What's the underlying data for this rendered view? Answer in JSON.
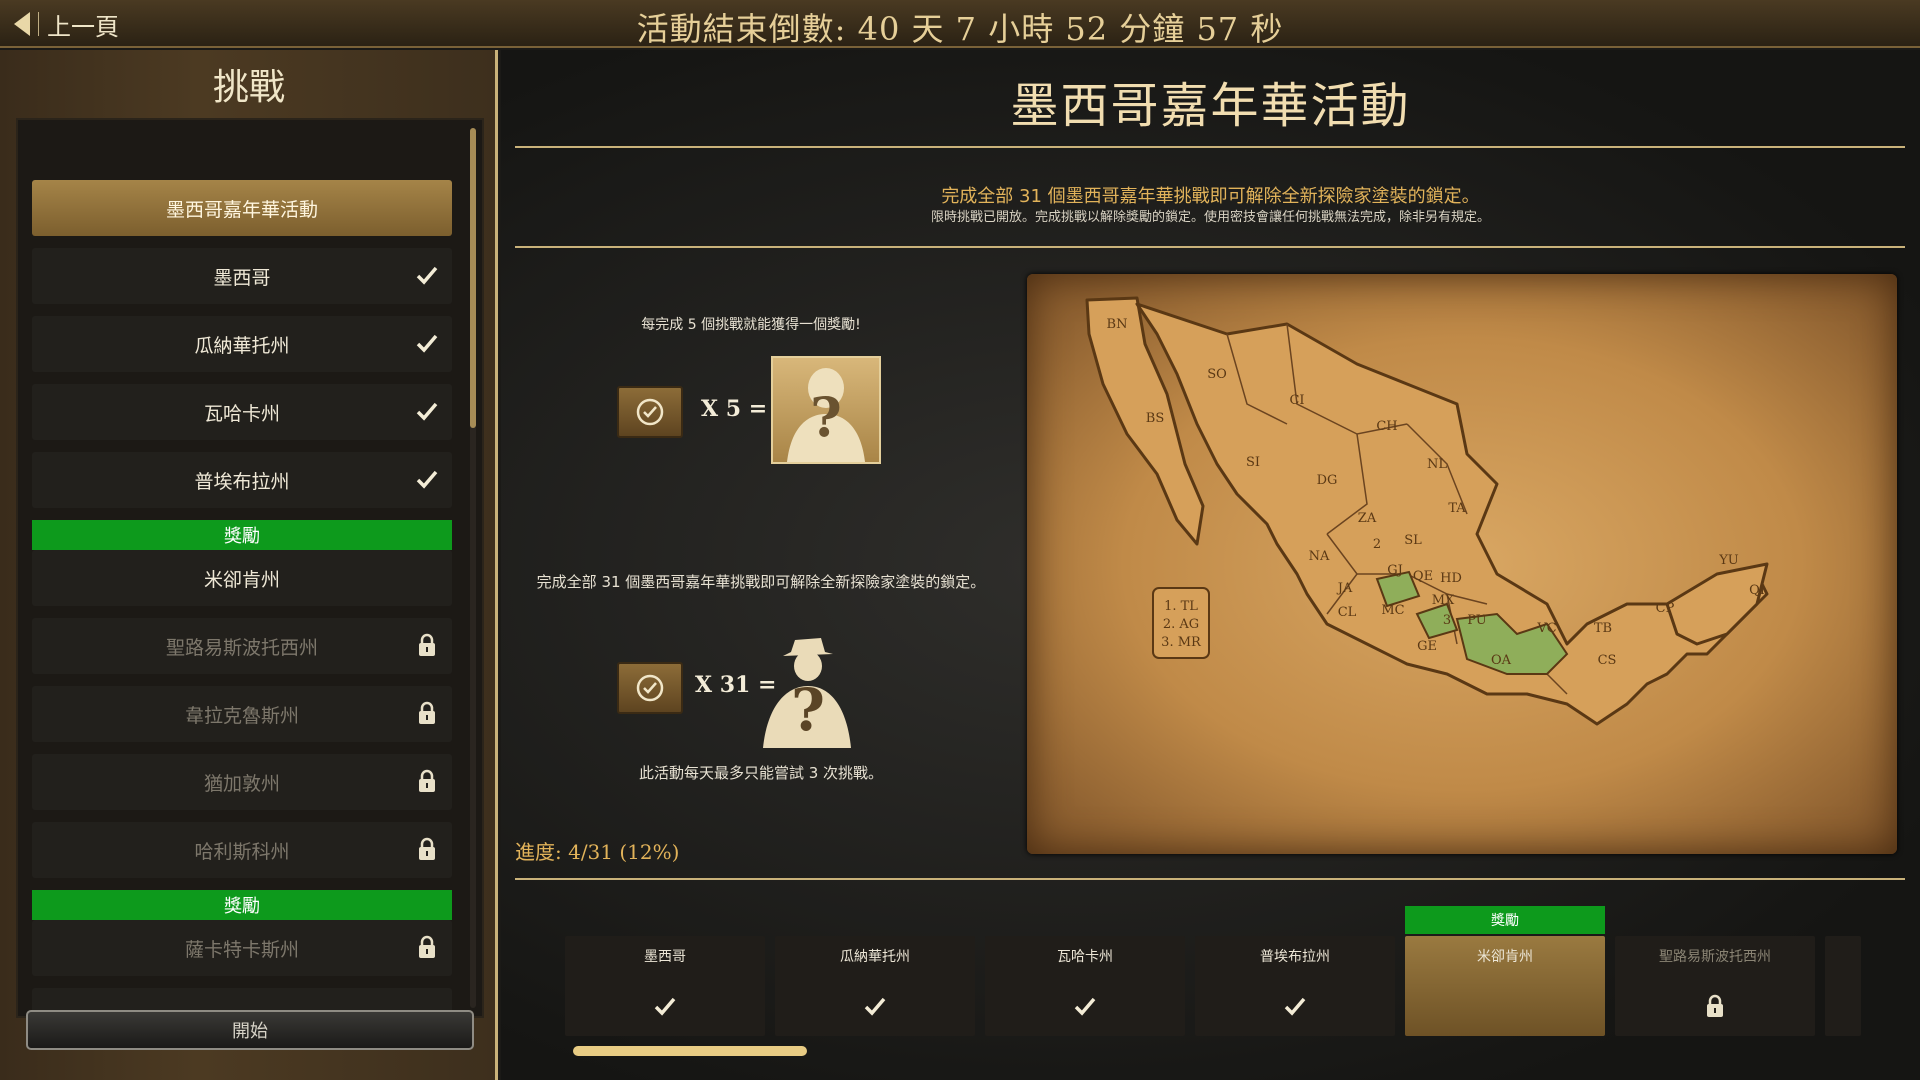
{
  "header": {
    "back_label": "上一頁",
    "countdown": "活動結束倒數: 40 天 7 小時 52 分鐘 57 秒"
  },
  "sidebar": {
    "title": "挑戰",
    "items": [
      {
        "label": "墨西哥嘉年華活動",
        "state": "active"
      },
      {
        "label": "墨西哥",
        "state": "done"
      },
      {
        "label": "瓜納華托州",
        "state": "done"
      },
      {
        "label": "瓦哈卡州",
        "state": "done"
      },
      {
        "label": "普埃布拉州",
        "state": "done"
      },
      {
        "label": "米卻肯州",
        "state": "open"
      },
      {
        "label": "聖路易斯波托西州",
        "state": "locked"
      },
      {
        "label": "韋拉克魯斯州",
        "state": "locked"
      },
      {
        "label": "猶加敦州",
        "state": "locked"
      },
      {
        "label": "哈利斯科州",
        "state": "locked"
      },
      {
        "label": "薩卡特卡斯州",
        "state": "locked"
      }
    ],
    "reward_label": "獎勵",
    "start_label": "開始"
  },
  "main": {
    "title": "墨西哥嘉年華活動",
    "desc_main": "完成全部 31 個墨西哥嘉年華挑戰即可解除全新探險家塗裝的鎖定。",
    "desc_sub": "限時挑戰已開放。完成挑戰以解除獎勵的鎖定。使用密技會讓任何挑戰無法完成，除非另有規定。",
    "reward5_caption": "每完成 5 個挑戰就能獲得一個獎勵!",
    "reward5_mult": "X 5 =",
    "reward31_caption": "完成全部 31 個墨西哥嘉年華挑戰即可解除全新探險家塗裝的鎖定。",
    "reward31_mult": "X 31 =",
    "daily_note": "此活動每天最多只能嘗試 3 次挑戰。",
    "progress": "進度: 4/31 (12%)"
  },
  "map": {
    "legend": [
      "1. TL",
      "2. AG",
      "3. MR"
    ],
    "labels": [
      "BN",
      "SO",
      "CI",
      "CH",
      "BS",
      "SI",
      "DG",
      "NL",
      "TA",
      "ZA",
      "SL",
      "NA",
      "JA",
      "GJ",
      "QE",
      "HD",
      "MX",
      "MC",
      "CL",
      "PU",
      "GE",
      "OA",
      "VC",
      "TB",
      "CP",
      "CS",
      "YU",
      "QI",
      "2",
      "3"
    ],
    "completed_color": "#8fae5a"
  },
  "carousel": {
    "reward_tag": "獎勵",
    "cards": [
      {
        "label": "墨西哥",
        "state": "done"
      },
      {
        "label": "瓜納華托州",
        "state": "done"
      },
      {
        "label": "瓦哈卡州",
        "state": "done"
      },
      {
        "label": "普埃布拉州",
        "state": "done"
      },
      {
        "label": "米卻肯州",
        "state": "active"
      },
      {
        "label": "聖路易斯波托西州",
        "state": "locked"
      }
    ]
  },
  "icons": {
    "done": "check-icon",
    "locked": "lock-icon",
    "back": "back-arrow-icon"
  },
  "colors": {
    "accent_gold": "#c9b27a",
    "reward_green": "#0d9a1c",
    "text_highlight": "#e2b35a"
  }
}
